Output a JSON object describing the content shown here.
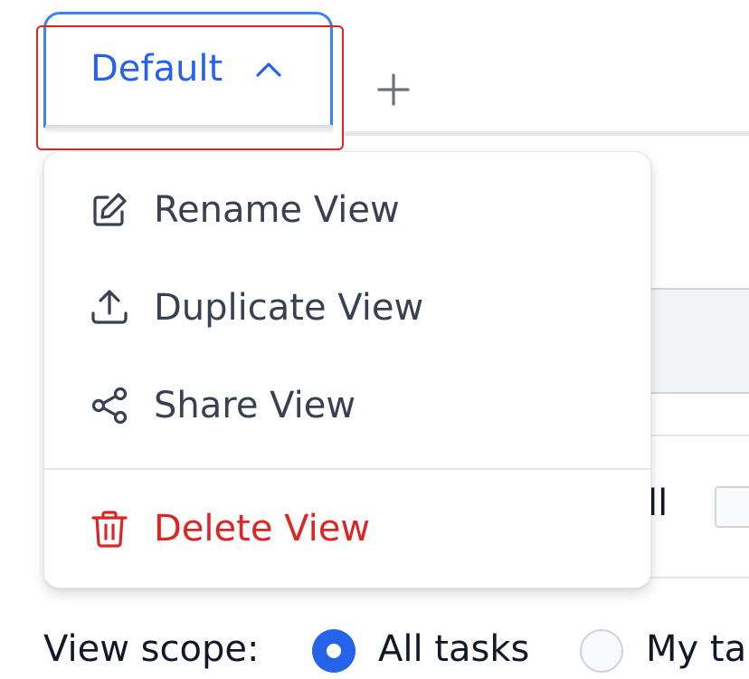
{
  "tabs": {
    "active": {
      "label": "Default",
      "expanded": true
    },
    "add_tab_icon": "plus-icon"
  },
  "background": {
    "fragment_text": "ll"
  },
  "view_menu": {
    "items": [
      {
        "label": "Rename View",
        "icon": "edit-icon"
      },
      {
        "label": "Duplicate View",
        "icon": "upload-icon"
      },
      {
        "label": "Share View",
        "icon": "share-icon"
      },
      {
        "label": "Delete View",
        "icon": "trash-icon",
        "destructive": true
      }
    ]
  },
  "view_scope": {
    "label": "View scope:",
    "options": [
      {
        "label": "All tasks",
        "selected": true
      },
      {
        "label": "My ta",
        "selected": false
      }
    ]
  },
  "colors": {
    "accent": "#2563eb",
    "danger": "#dc2626",
    "highlight": "#dc2626",
    "text": "#374151"
  }
}
